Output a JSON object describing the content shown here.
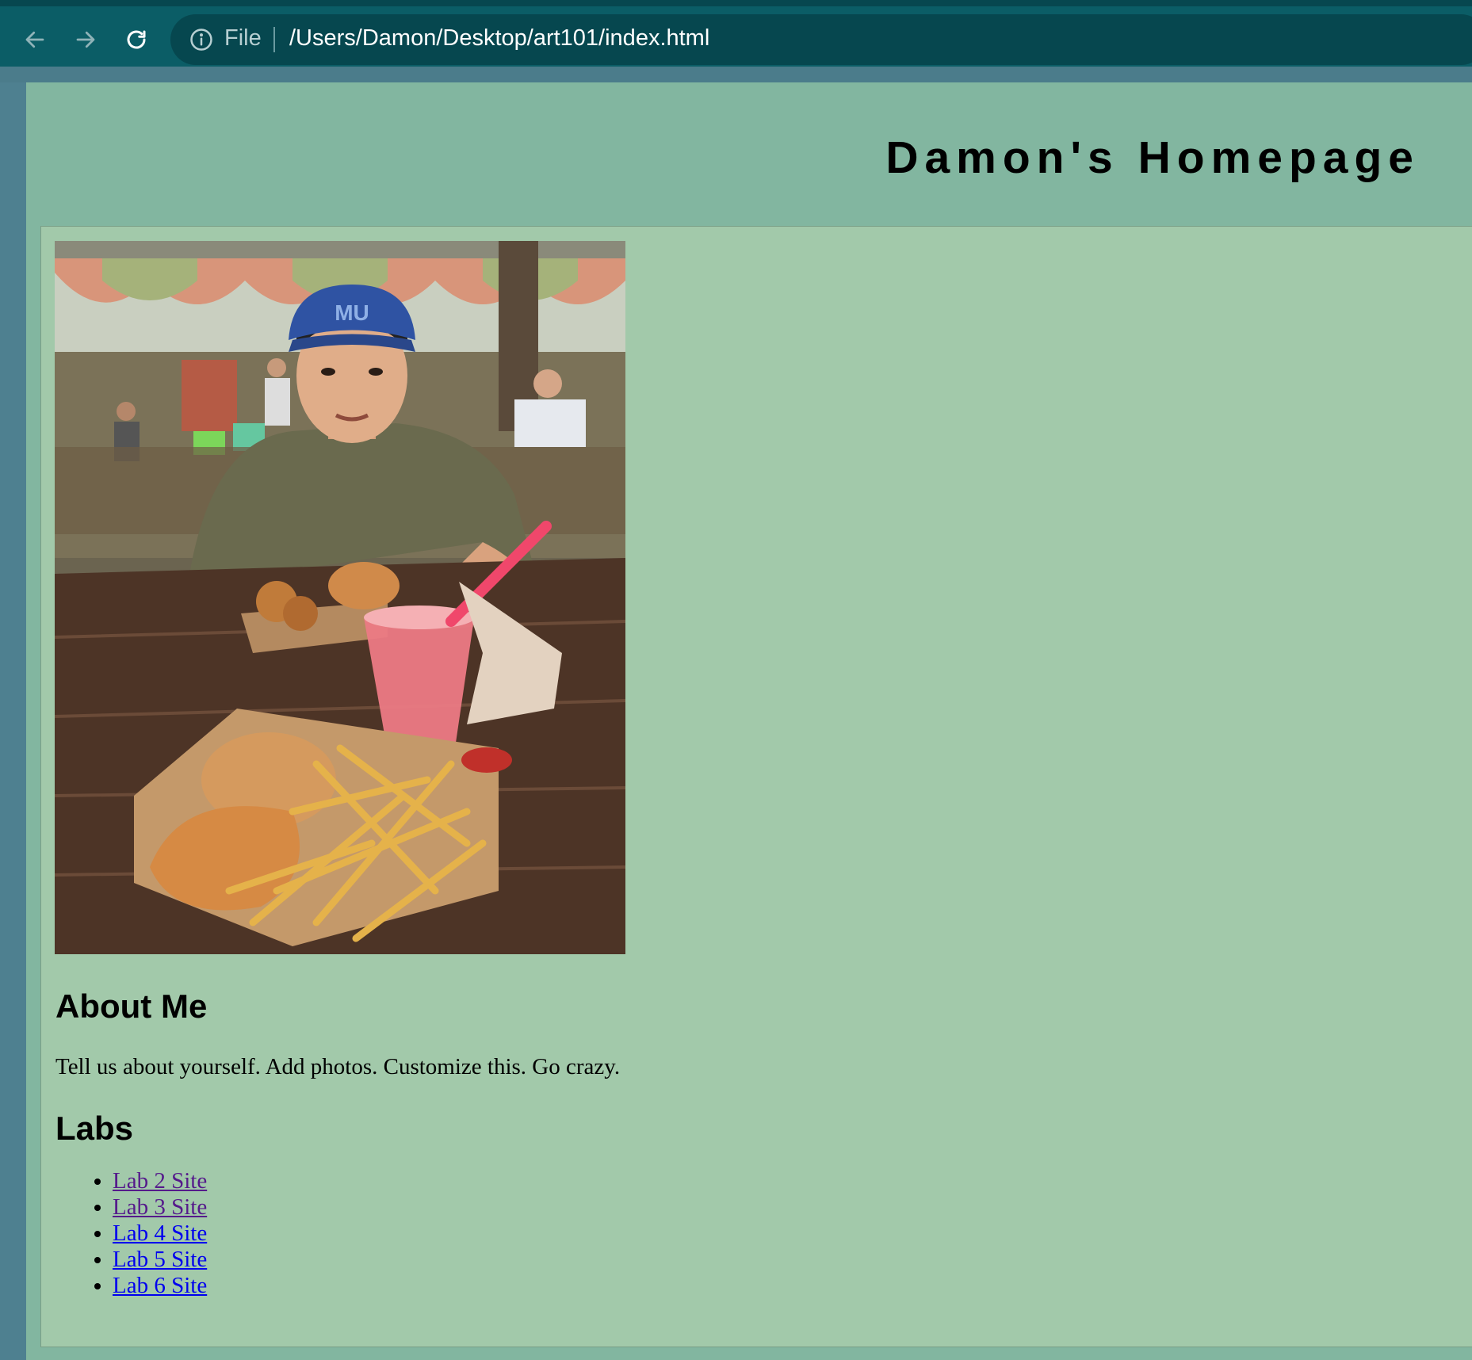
{
  "browser": {
    "back_icon": "arrow-left-icon",
    "forward_icon": "arrow-right-icon",
    "reload_icon": "reload-icon",
    "info_icon": "info-circle-icon",
    "scheme_label": "File",
    "url": "/Users/Damon/Desktop/art101/index.html"
  },
  "page": {
    "title": "Damon's Homepage",
    "about": {
      "heading": "About Me",
      "text": "Tell us about yourself. Add photos. Customize this. Go crazy."
    },
    "labs": {
      "heading": "Labs",
      "items": [
        {
          "label": "Lab 2 Site",
          "visited": true
        },
        {
          "label": "Lab 3 Site",
          "visited": true
        },
        {
          "label": "Lab 4 Site",
          "visited": false
        },
        {
          "label": "Lab 5 Site",
          "visited": false
        },
        {
          "label": "Lab 6 Site",
          "visited": false
        }
      ]
    }
  },
  "colors": {
    "toolbar": "#0b5d66",
    "page_bg": "#82b6a0",
    "content_bg": "#a2c9aa",
    "link": "#0000ee",
    "visited_link": "#551a8b"
  }
}
